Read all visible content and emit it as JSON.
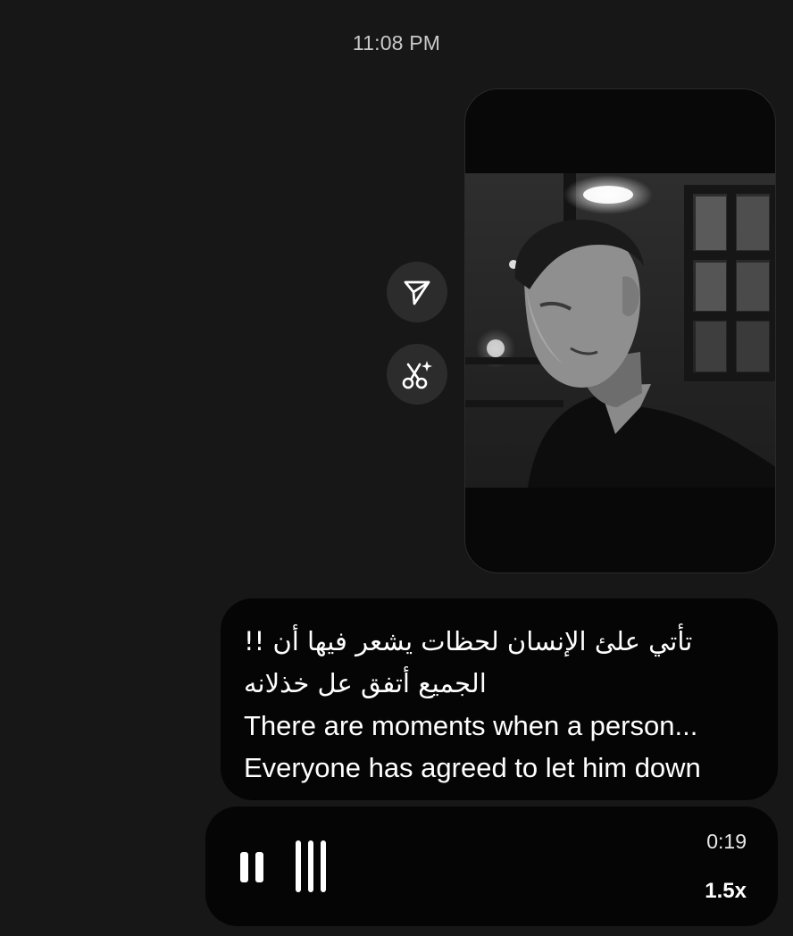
{
  "header": {
    "timestamp": "11:08 PM"
  },
  "video_message": {
    "actions": [
      {
        "name": "share",
        "icon": "send-icon"
      },
      {
        "name": "remix",
        "icon": "scissors-sparkle-icon"
      }
    ]
  },
  "caption": {
    "lines": [
      "تأتي علئ الإنسان لحظات يشعر فيها أن !!",
      "الجميع أتفق عل خذلانه",
      "There are moments when a person...",
      "Everyone has agreed to let him down"
    ]
  },
  "audio_message": {
    "duration": "0:19",
    "playback_speed": "1.5x",
    "state": "playing",
    "icons": {
      "control": "pause-icon",
      "waveform": "waveform-icon"
    }
  },
  "colors": {
    "background": "#171717",
    "bubble": "#050505",
    "action_button": "#2c2c2c",
    "text": "#ffffff"
  }
}
